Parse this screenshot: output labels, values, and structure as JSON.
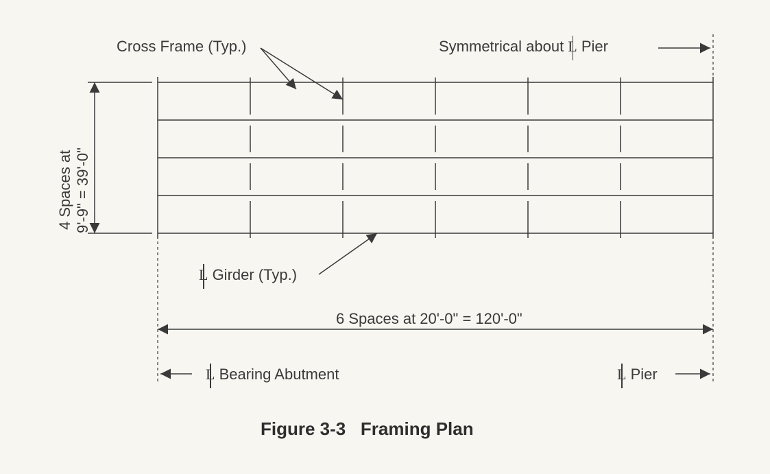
{
  "figure": {
    "caption_left": "Figure 3-3",
    "caption_right": "Framing Plan"
  },
  "labels": {
    "cross_frame": "Cross Frame (Typ.)",
    "symmetrical_pre": "Symmetrical about ",
    "symmetrical_cl": "L",
    "symmetrical_post": " Pier",
    "vert_dim_line1": "4 Spaces at",
    "vert_dim_line2": "9'-9\" = 39'-0\"",
    "girder_cl": "L",
    "girder_post": " Girder (Typ.)",
    "horiz_dim": "6 Spaces at 20'-0\" = 120'-0\"",
    "bearing_abutment_cl": "L",
    "bearing_abutment_post": " Bearing Abutment",
    "pier_cl": "L",
    "pier_post": " Pier"
  },
  "chart_data": {
    "type": "diagram",
    "title": "Framing Plan",
    "description": "Bridge framing plan showing longitudinal girders and transverse cross frames; symmetrical about pier centerline",
    "horizontal": {
      "spaces": 6,
      "space_length_ft_in": "20'-0\"",
      "total_ft_in": "120'-0\""
    },
    "vertical": {
      "spaces": 4,
      "space_length_ft_in": "9'-9\"",
      "total_ft_in": "39'-0\""
    },
    "callouts": [
      "Cross Frame (Typ.)",
      "℄ Girder (Typ.)",
      "℄ Bearing Abutment",
      "℄ Pier",
      "Symmetrical about ℄ Pier"
    ]
  }
}
